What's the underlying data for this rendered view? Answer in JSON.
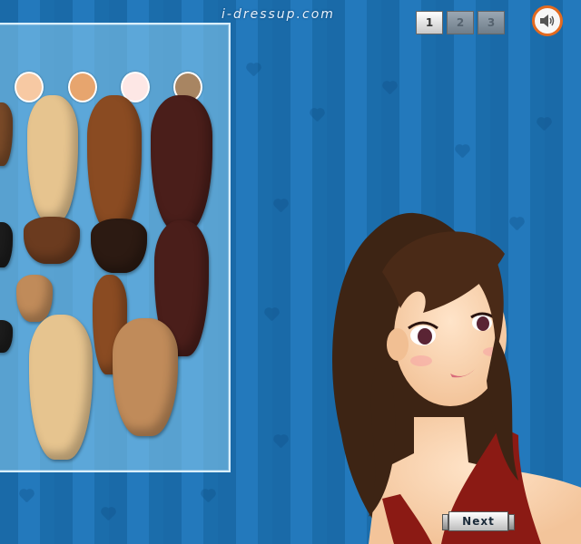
{
  "site": {
    "logo_text": "i-dressup.com"
  },
  "pager": {
    "pages": [
      "1",
      "2",
      "3"
    ],
    "active_page": "1"
  },
  "sound": {
    "icon": "speaker-icon"
  },
  "nav": {
    "next_label": "Next"
  },
  "skin_tones": [
    "#f7c9a3",
    "#e7a56e",
    "#fde7e5",
    "#a88562"
  ],
  "hair_colors": [
    "#7a4a28",
    "#e6c48f",
    "#8a4b22",
    "#4a1e1a",
    "#1c1c1c",
    "#6b3b1f",
    "#2c1a12",
    "#c08b5a"
  ],
  "colors": {
    "background": "#1f73b3",
    "accent": "#e46a1f"
  }
}
